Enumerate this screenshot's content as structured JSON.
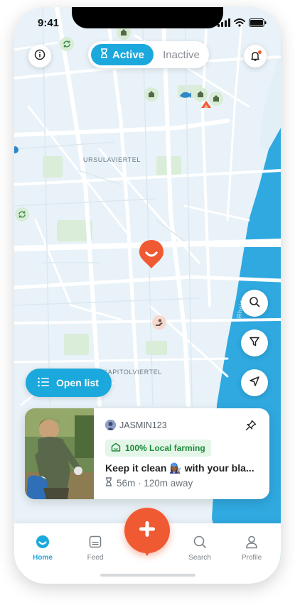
{
  "status": {
    "time": "9:41"
  },
  "header": {
    "info_icon": "info-icon",
    "toggle": {
      "active_label": "Active",
      "inactive_label": "Inactive"
    },
    "notification_icon": "bell-icon"
  },
  "map": {
    "labels": [
      "URSULAVIERTEL",
      "KAPITOLVIERTEL",
      "Rhein"
    ],
    "colors": {
      "land": "#e8f2f8",
      "water": "#2fa9e0",
      "road": "#ffffff",
      "park": "#dbeedd"
    }
  },
  "map_controls": {
    "search": "search-icon",
    "filter": "filter-icon",
    "locate": "navigation-icon"
  },
  "open_list": {
    "label": "Open list"
  },
  "card": {
    "username": "JASMIN123",
    "tag": "100% Local farming",
    "title": "Keep it clean 👩🏾‍🔧 with your bla...",
    "meta": "56m · 120m away"
  },
  "tabbar": {
    "items": [
      {
        "label": "Home",
        "icon": "home-icon"
      },
      {
        "label": "Feed",
        "icon": "feed-icon"
      },
      {
        "label": "Search",
        "icon": "search-icon"
      },
      {
        "label": "Profile",
        "icon": "profile-icon"
      }
    ]
  },
  "accent": "#1ba8dc",
  "brand_orange": "#f05a32"
}
